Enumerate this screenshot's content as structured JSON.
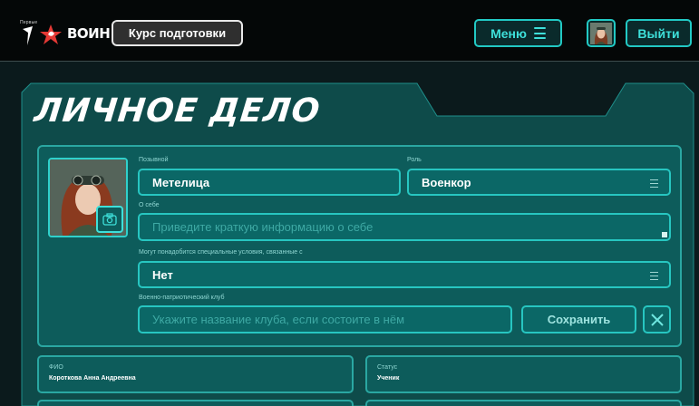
{
  "header": {
    "logo_first_small": "Первые",
    "logo_voin": "ВОИН",
    "course_button": "Курс подготовки",
    "menu_button": "Меню",
    "exit_button": "Выйти"
  },
  "page": {
    "title": "ЛИЧНОЕ ДЕЛО"
  },
  "profile": {
    "callsign": {
      "label": "Позывной",
      "value": "Метелица"
    },
    "role": {
      "label": "Роль",
      "value": "Военкор"
    },
    "about": {
      "label": "О себе",
      "placeholder": "Приведите краткую информацию о себе"
    },
    "conditions": {
      "label": "Могут понадобится специальные условия, связанные с",
      "value": "Нет"
    },
    "club": {
      "label": "Военно-патриотический клуб",
      "placeholder": "Укажите название клуба, если состоите в нём"
    },
    "save_button": "Сохранить"
  },
  "info": {
    "fio": {
      "label": "ФИО",
      "value": "Короткова Анна Андреевна"
    },
    "status": {
      "label": "Статус",
      "value": "Ученик"
    }
  },
  "colors": {
    "accent": "#22c9c4",
    "panel": "#0d5c5b",
    "field": "#0b6766"
  },
  "icons": [
    "menu-icon",
    "camera-icon",
    "close-icon",
    "dropdown-lines-icon"
  ]
}
